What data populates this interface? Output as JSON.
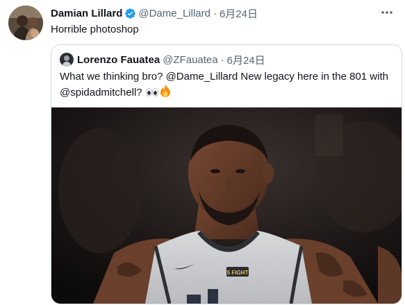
{
  "tweet": {
    "author_name": "Damian Lillard",
    "author_handle": "@Dame_Lillard",
    "separator": "·",
    "date": "6月24日",
    "text": "Horrible photoshop"
  },
  "quoted": {
    "author_name": "Lorenzo Fauatea",
    "author_handle": "@ZFauatea",
    "separator": "·",
    "date": "6月24日",
    "text_before": "What we thinking bro? ",
    "mention1": "@Dame_Lillard",
    "text_mid": " New legacy here in the 801 with ",
    "mention2": "@spidadmitchell",
    "text_after": "? ",
    "emojis": [
      "eyes",
      "fire"
    ],
    "media": {
      "jersey_badge": "5 FIGHT"
    }
  },
  "colors": {
    "text": "#0f1419",
    "secondary": "#536471",
    "verified": "#1d9bf0",
    "border": "#cfd9de"
  }
}
